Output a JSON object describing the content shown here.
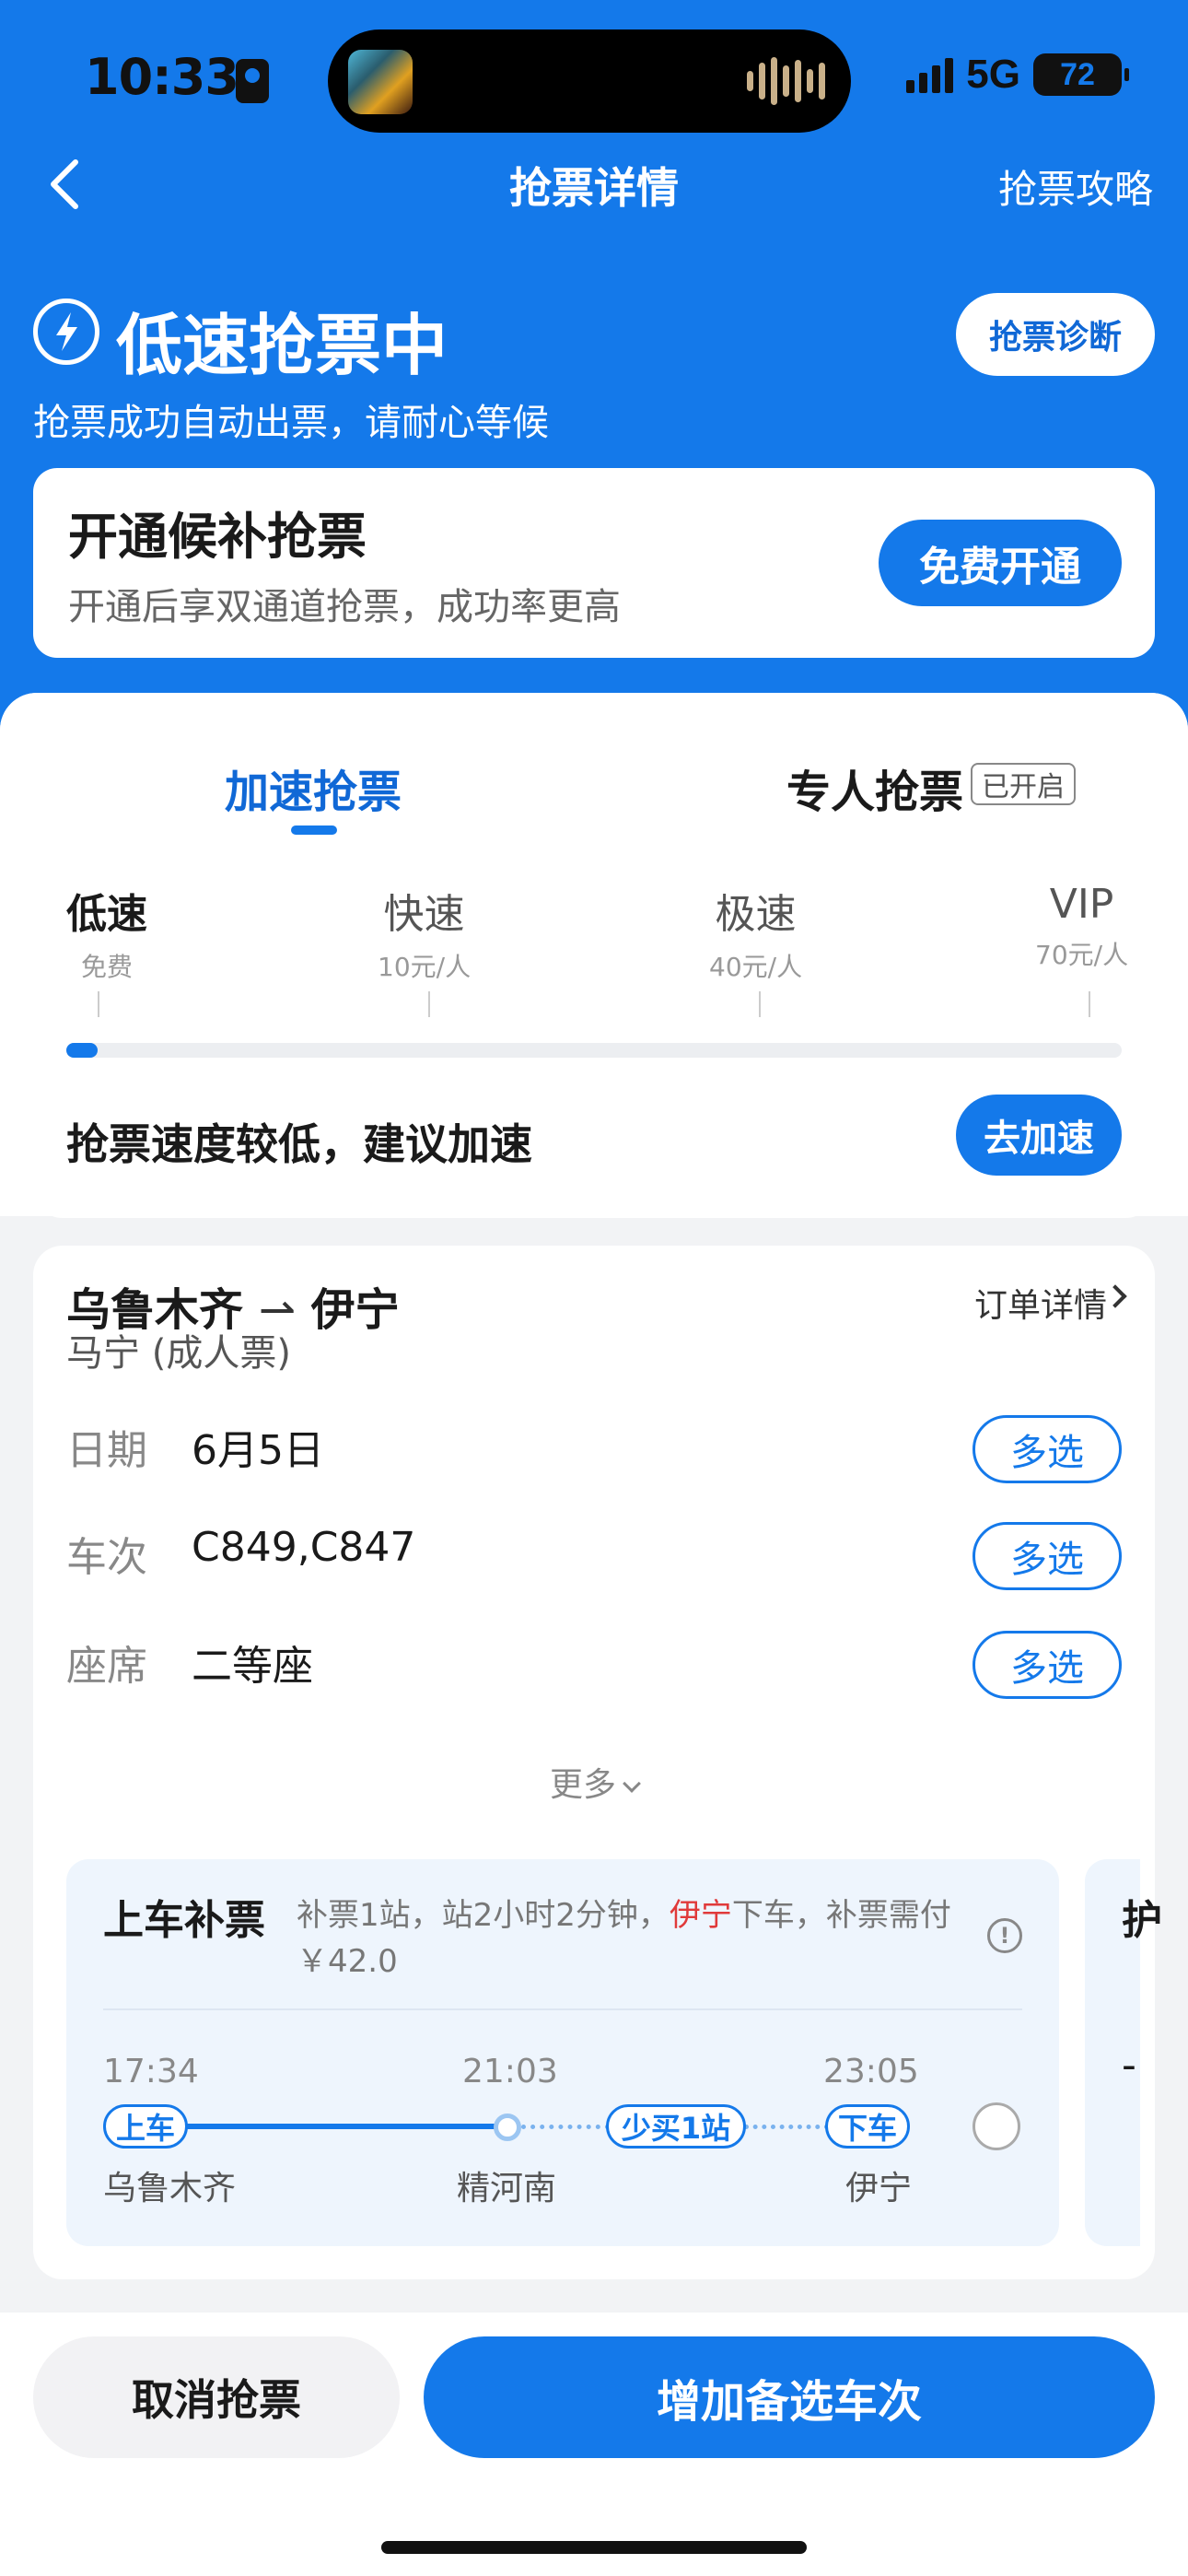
{
  "status_bar": {
    "time": "10:33",
    "network": "5G",
    "battery": "72",
    "signal_bars": 4
  },
  "nav": {
    "title": "抢票详情",
    "guide": "抢票攻略"
  },
  "hero": {
    "title": "低速抢票中",
    "subtitle": "抢票成功自动出票，请耐心等候",
    "diagnose_button": "抢票诊断"
  },
  "promo": {
    "title": "开通候补抢票",
    "subtitle": "开通后享双通道抢票，成功率更高",
    "button": "免费开通"
  },
  "tabs": {
    "speed": "加速抢票",
    "personal": "专人抢票",
    "personal_badge": "已开启"
  },
  "tiers": [
    {
      "name": "低速",
      "price": "免费",
      "active": true
    },
    {
      "name": "快速",
      "price": "10元/人",
      "active": false
    },
    {
      "name": "极速",
      "price": "40元/人",
      "active": false
    },
    {
      "name": "VIP",
      "price": "70元/人",
      "active": false
    }
  ],
  "speed_level_fraction": 0.03,
  "speed_hint": "抢票速度较低，建议加速",
  "speed_button": "去加速",
  "order": {
    "route_from": "乌鲁木齐",
    "route_to": "伊宁",
    "passenger": "马宁 (成人票)",
    "detail_link": "订单详情",
    "rows": [
      {
        "label": "日期",
        "value": "6月5日",
        "button": "多选"
      },
      {
        "label": "车次",
        "value": "C849,C847",
        "button": "多选"
      },
      {
        "label": "座席",
        "value": "二等座",
        "button": "多选"
      }
    ],
    "more": "更多"
  },
  "option": {
    "title": "上车补票",
    "desc_part1": "补票1站，站2小时2分钟，",
    "desc_highlight": "伊宁",
    "desc_part2": "下车，补票需付￥42.0",
    "times": {
      "depart": "17:34",
      "mid": "21:03",
      "arrive": "23:05"
    },
    "tags": {
      "board": "上车",
      "extra": "少买1站",
      "alight": "下车"
    },
    "stations": {
      "from": "乌鲁木齐",
      "mid": "精河南",
      "to": "伊宁"
    },
    "peek_title": "护",
    "peek_dash": "-"
  },
  "actions": {
    "cancel": "取消抢票",
    "add": "增加备选车次"
  },
  "colors": {
    "brand": "#1479ea",
    "highlight_red": "#e03a3a",
    "card_tint": "#eef5fd"
  }
}
